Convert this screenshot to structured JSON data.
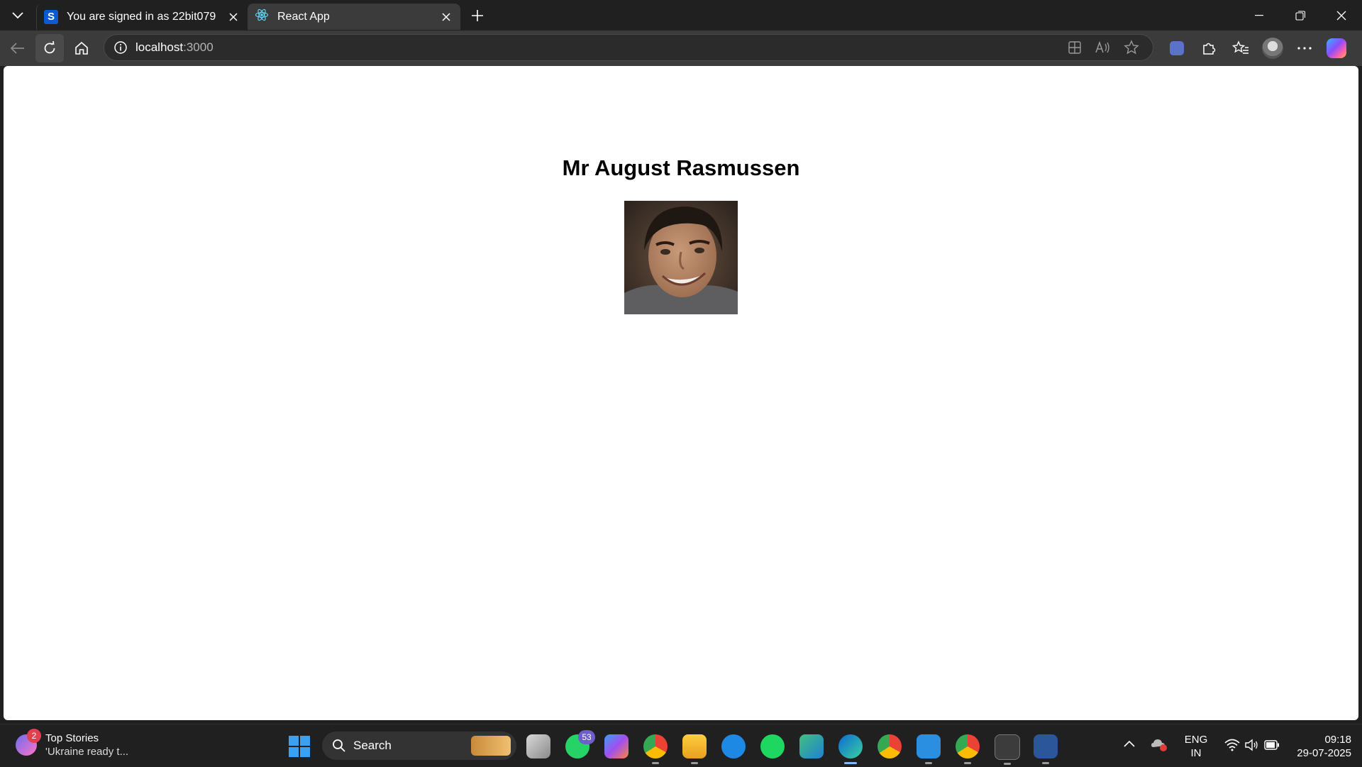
{
  "browser": {
    "tabs": [
      {
        "label": "You are signed in as 22bit079",
        "favicon": "S",
        "active": false
      },
      {
        "label": "React App",
        "favicon": "react-icon",
        "active": true
      }
    ],
    "address": {
      "host": "localhost",
      "port": ":3000"
    }
  },
  "page": {
    "heading": "Mr August Rasmussen",
    "photo_alt": "portrait photo"
  },
  "taskbar": {
    "news": {
      "title": "Top Stories",
      "subtitle": "'Ukraine ready t...",
      "badge": "2"
    },
    "search_label": "Search",
    "whatsapp_badge": "53",
    "lang_line1": "ENG",
    "lang_line2": "IN",
    "time": "09:18",
    "date": "29-07-2025"
  },
  "colors": {
    "accent": "#3aa0f2",
    "tab_active": "#3b3b3b",
    "chrome": "#202020"
  }
}
